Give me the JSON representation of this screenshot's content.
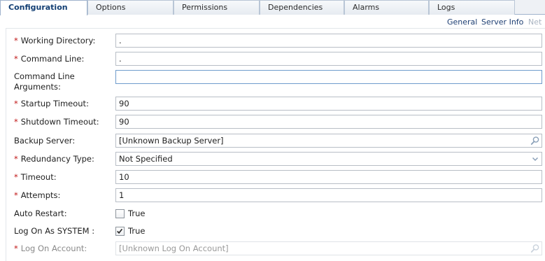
{
  "tabs": [
    {
      "label": "Configuration",
      "active": true
    },
    {
      "label": "Options"
    },
    {
      "label": "Permissions"
    },
    {
      "label": "Dependencies"
    },
    {
      "label": "Alarms"
    },
    {
      "label": "Logs"
    }
  ],
  "subnav": {
    "general": "General",
    "server_info": "Server Info",
    "truncated": "Net"
  },
  "required_marker": "*",
  "fields": {
    "working_directory": {
      "label": "Working Directory:",
      "value": "."
    },
    "command_line": {
      "label": "Command Line:",
      "value": "."
    },
    "command_line_arguments": {
      "label": "Command Line Arguments:",
      "value": ""
    },
    "startup_timeout": {
      "label": "Startup Timeout:",
      "value": "90"
    },
    "shutdown_timeout": {
      "label": "Shutdown Timeout:",
      "value": "90"
    },
    "backup_server": {
      "label": "Backup Server:",
      "value": "[Unknown Backup Server]"
    },
    "redundancy_type": {
      "label": "Redundancy Type:",
      "value": "Not Specified"
    },
    "timeout": {
      "label": "Timeout:",
      "value": "10"
    },
    "attempts": {
      "label": "Attempts:",
      "value": "1"
    },
    "auto_restart": {
      "label": "Auto Restart:",
      "option": "True",
      "checked": false
    },
    "log_on_as_system": {
      "label": "Log On As SYSTEM :",
      "option": "True",
      "checked": true
    },
    "log_on_account": {
      "label": "Log On Account:",
      "value": "[Unknown Log On Account]"
    }
  },
  "icons": {
    "search": "magnifier-icon",
    "dropdown": "chevron-down-icon",
    "checkmark": "checkmark-icon"
  },
  "colors": {
    "required": "#c01818",
    "link": "#1e3f73",
    "active_tab_text": "#123e73"
  }
}
